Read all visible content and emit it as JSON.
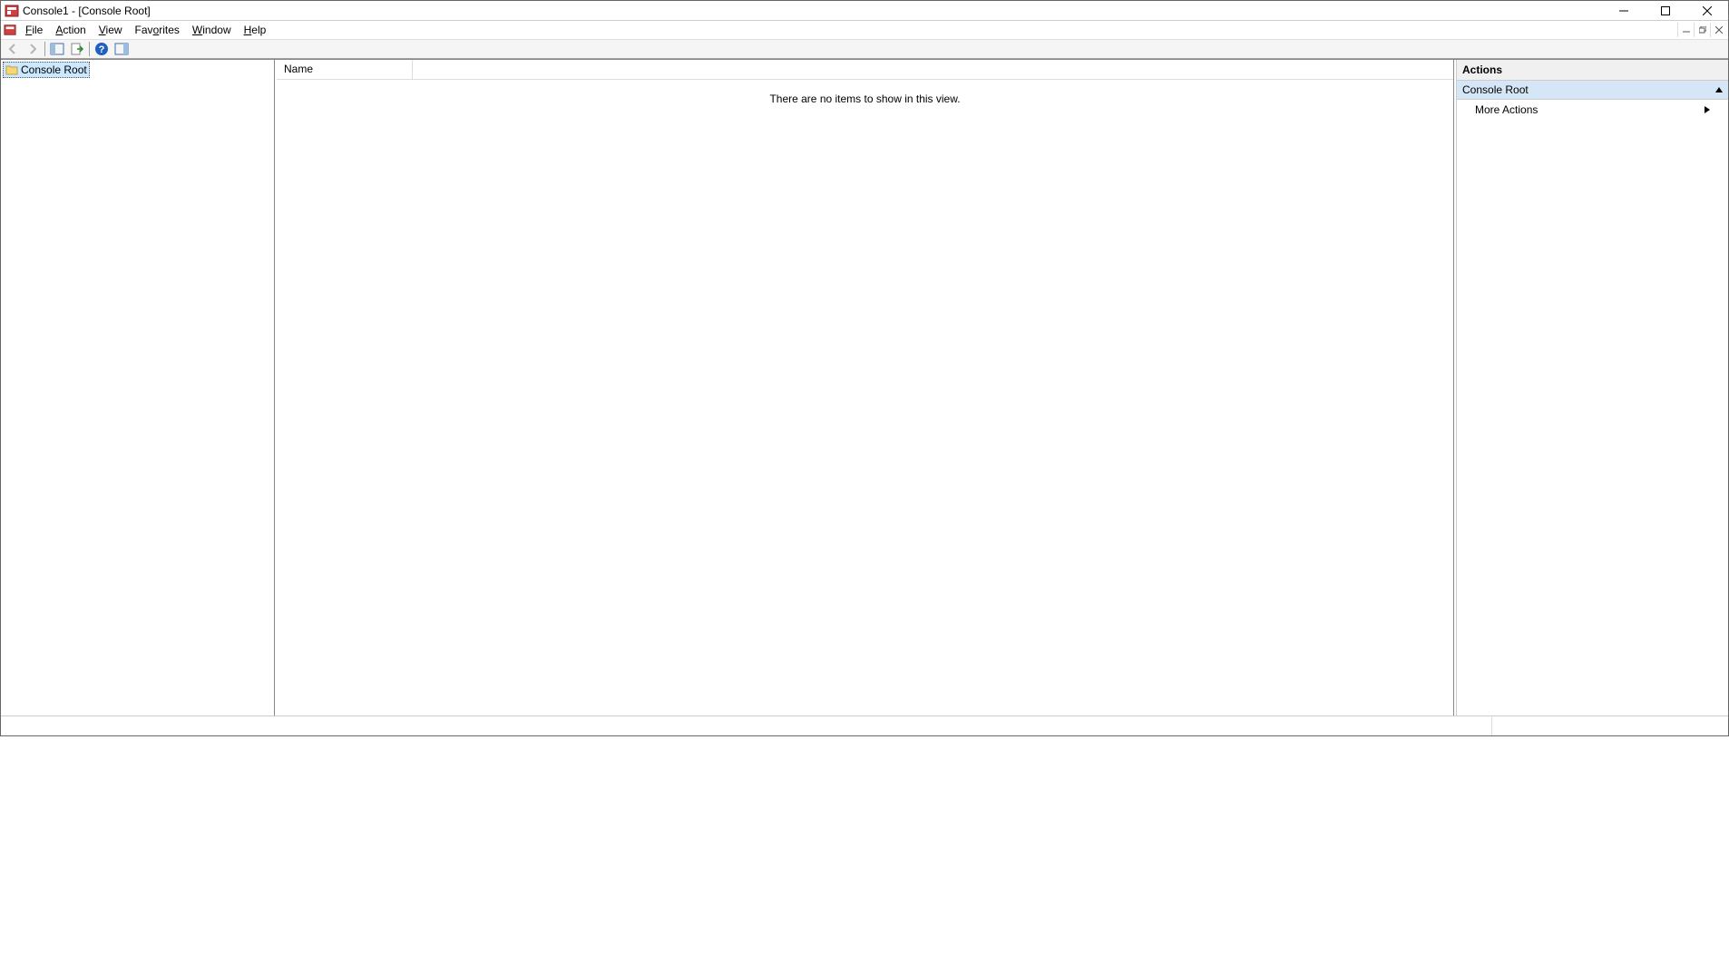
{
  "window": {
    "title": "Console1 - [Console Root]"
  },
  "menu": {
    "items": [
      "File",
      "Action",
      "View",
      "Favorites",
      "Window",
      "Help"
    ],
    "underlines": [
      "F",
      "A",
      "V",
      "o",
      "W",
      "H"
    ]
  },
  "tree": {
    "root_label": "Console Root"
  },
  "list": {
    "column_header": "Name",
    "empty_message": "There are no items to show in this view."
  },
  "actions": {
    "title": "Actions",
    "section": "Console Root",
    "more": "More Actions"
  }
}
